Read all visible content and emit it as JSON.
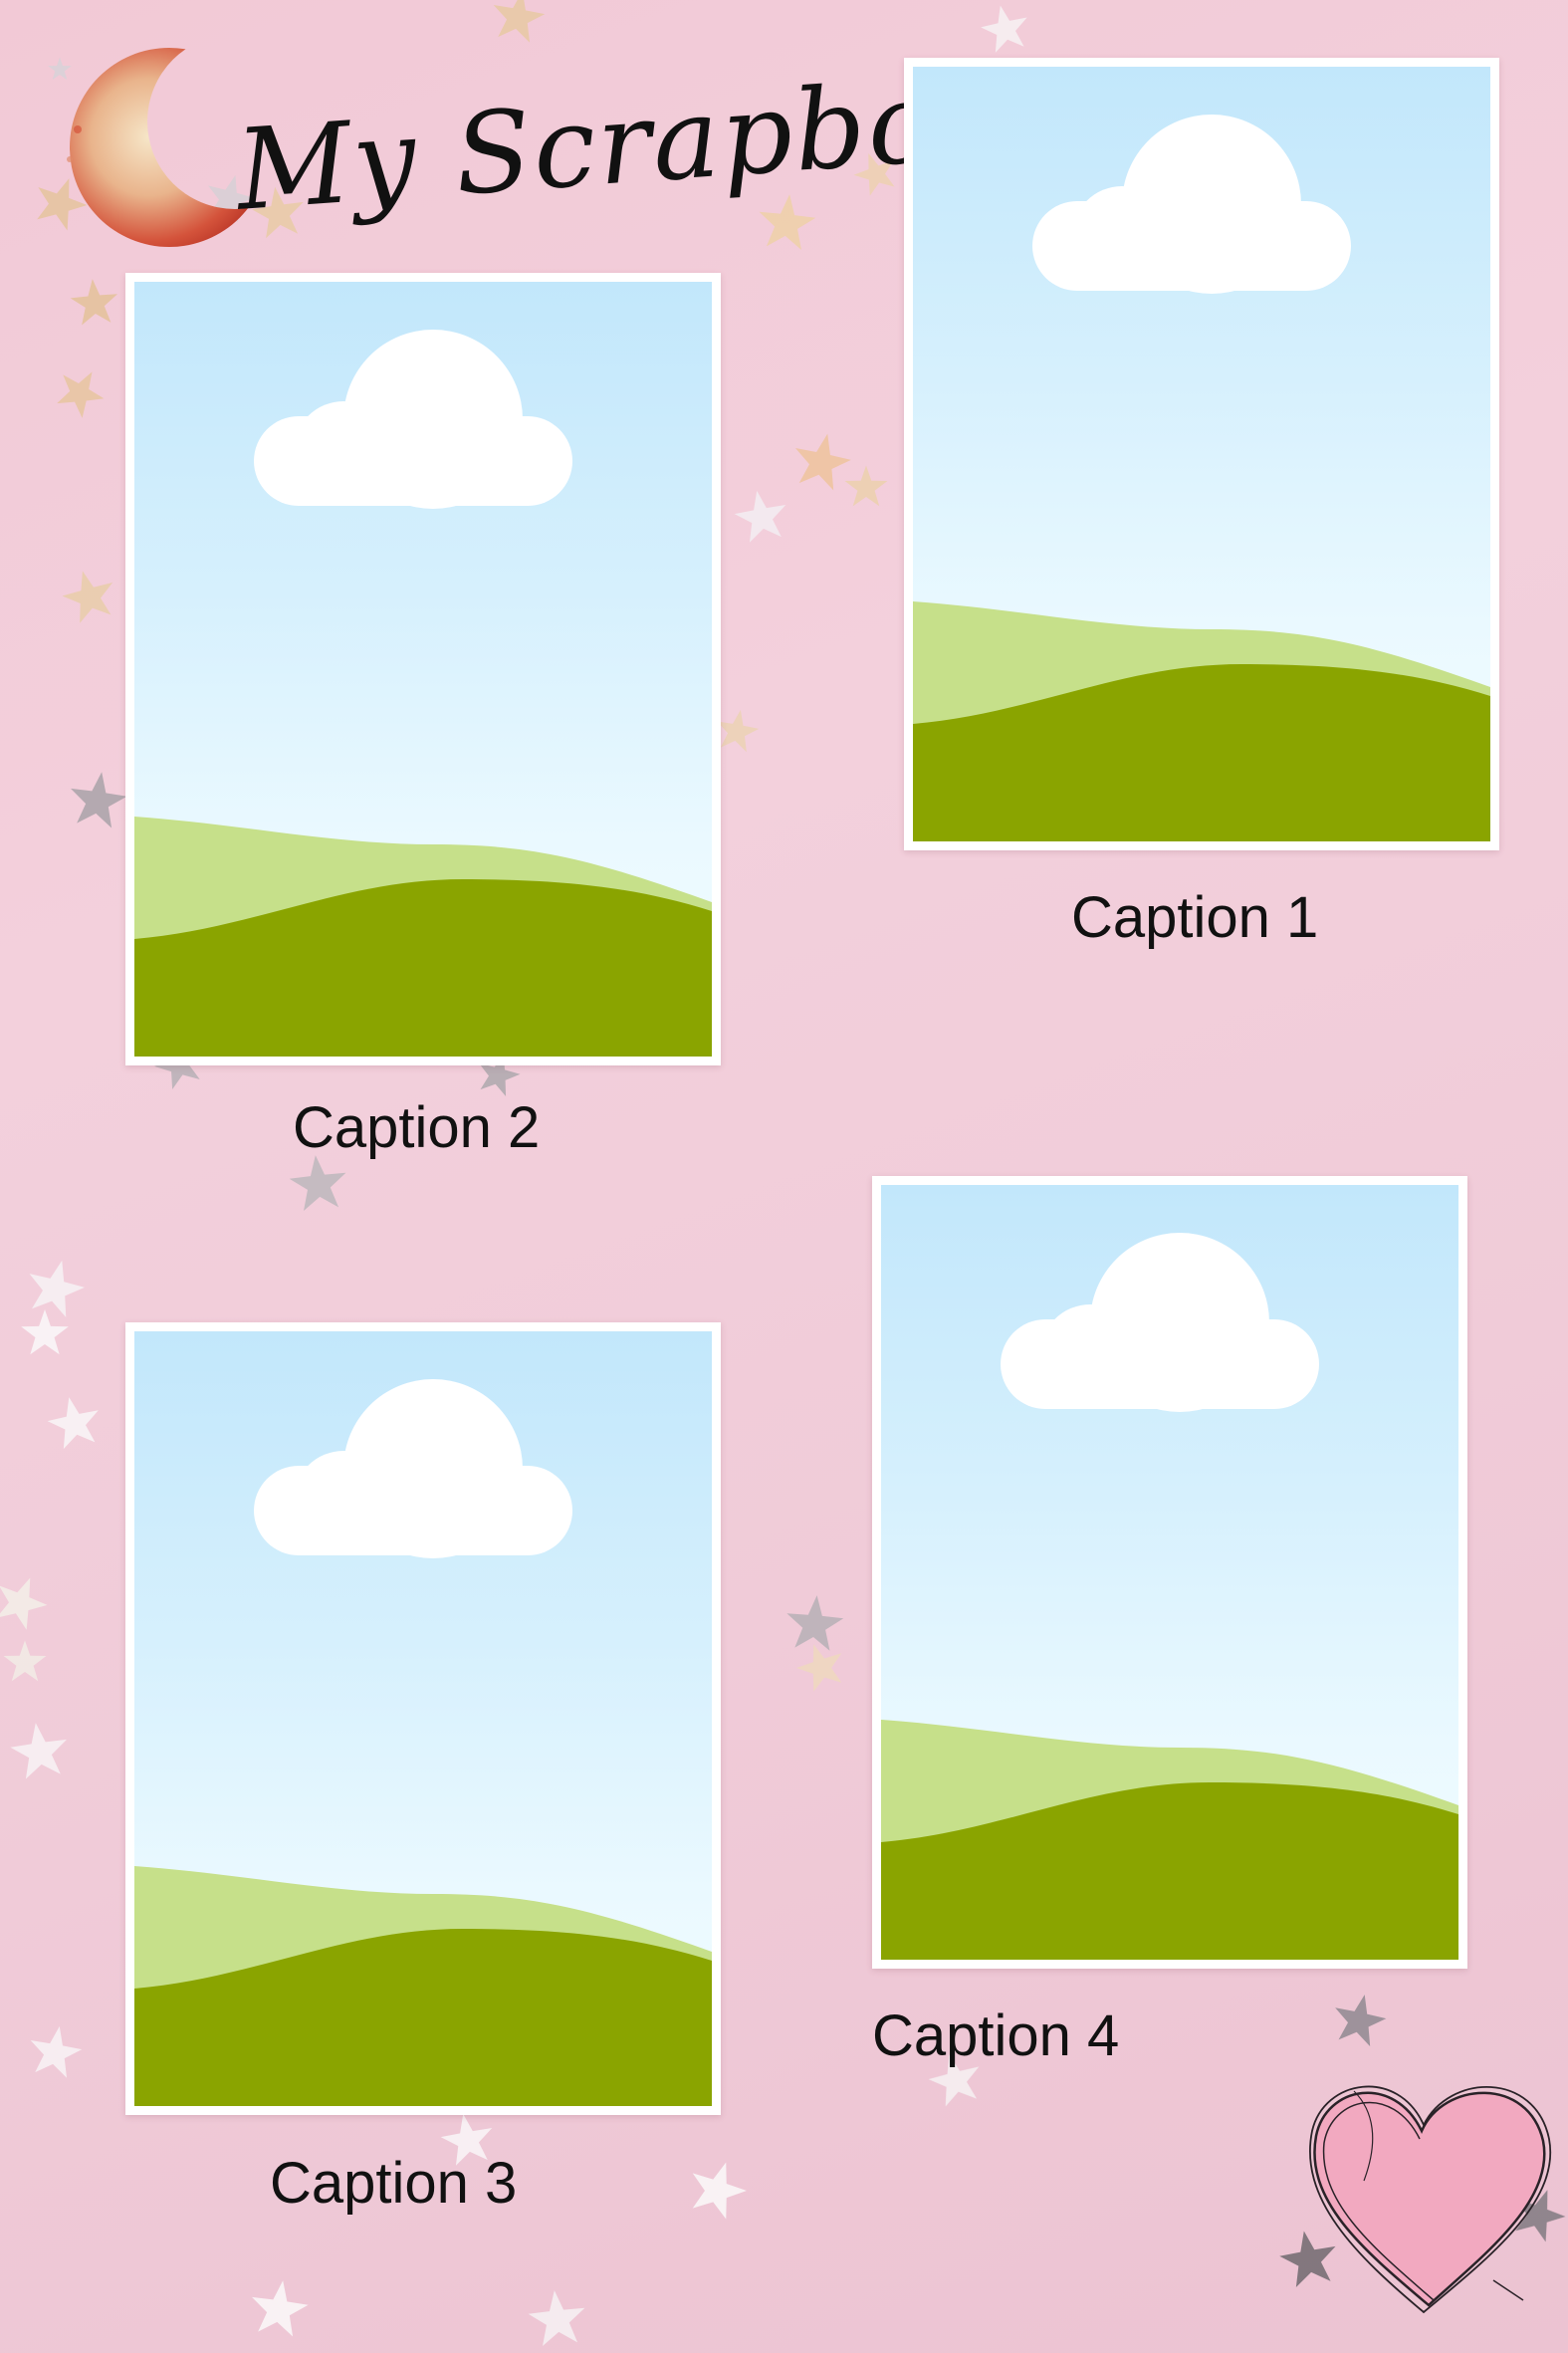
{
  "title": "My Scrapbook",
  "photos": [
    {
      "id": 1,
      "caption": "Caption 1"
    },
    {
      "id": 2,
      "caption": "Caption 2"
    },
    {
      "id": 3,
      "caption": "Caption 3"
    },
    {
      "id": 4,
      "caption": "Caption 4"
    }
  ],
  "colors": {
    "background": "#f2cbd8",
    "frame": "#ffffff",
    "sky_top": "#c2e7fb",
    "sky_bottom": "#f4fcff",
    "cloud": "#ffffff",
    "hill_light": "#c6e08a",
    "hill_dark": "#8aa400",
    "text": "#111111",
    "heart": "#f2a9c0"
  },
  "decorations": [
    "crescent-moon",
    "heart",
    "confetti-stars"
  ]
}
